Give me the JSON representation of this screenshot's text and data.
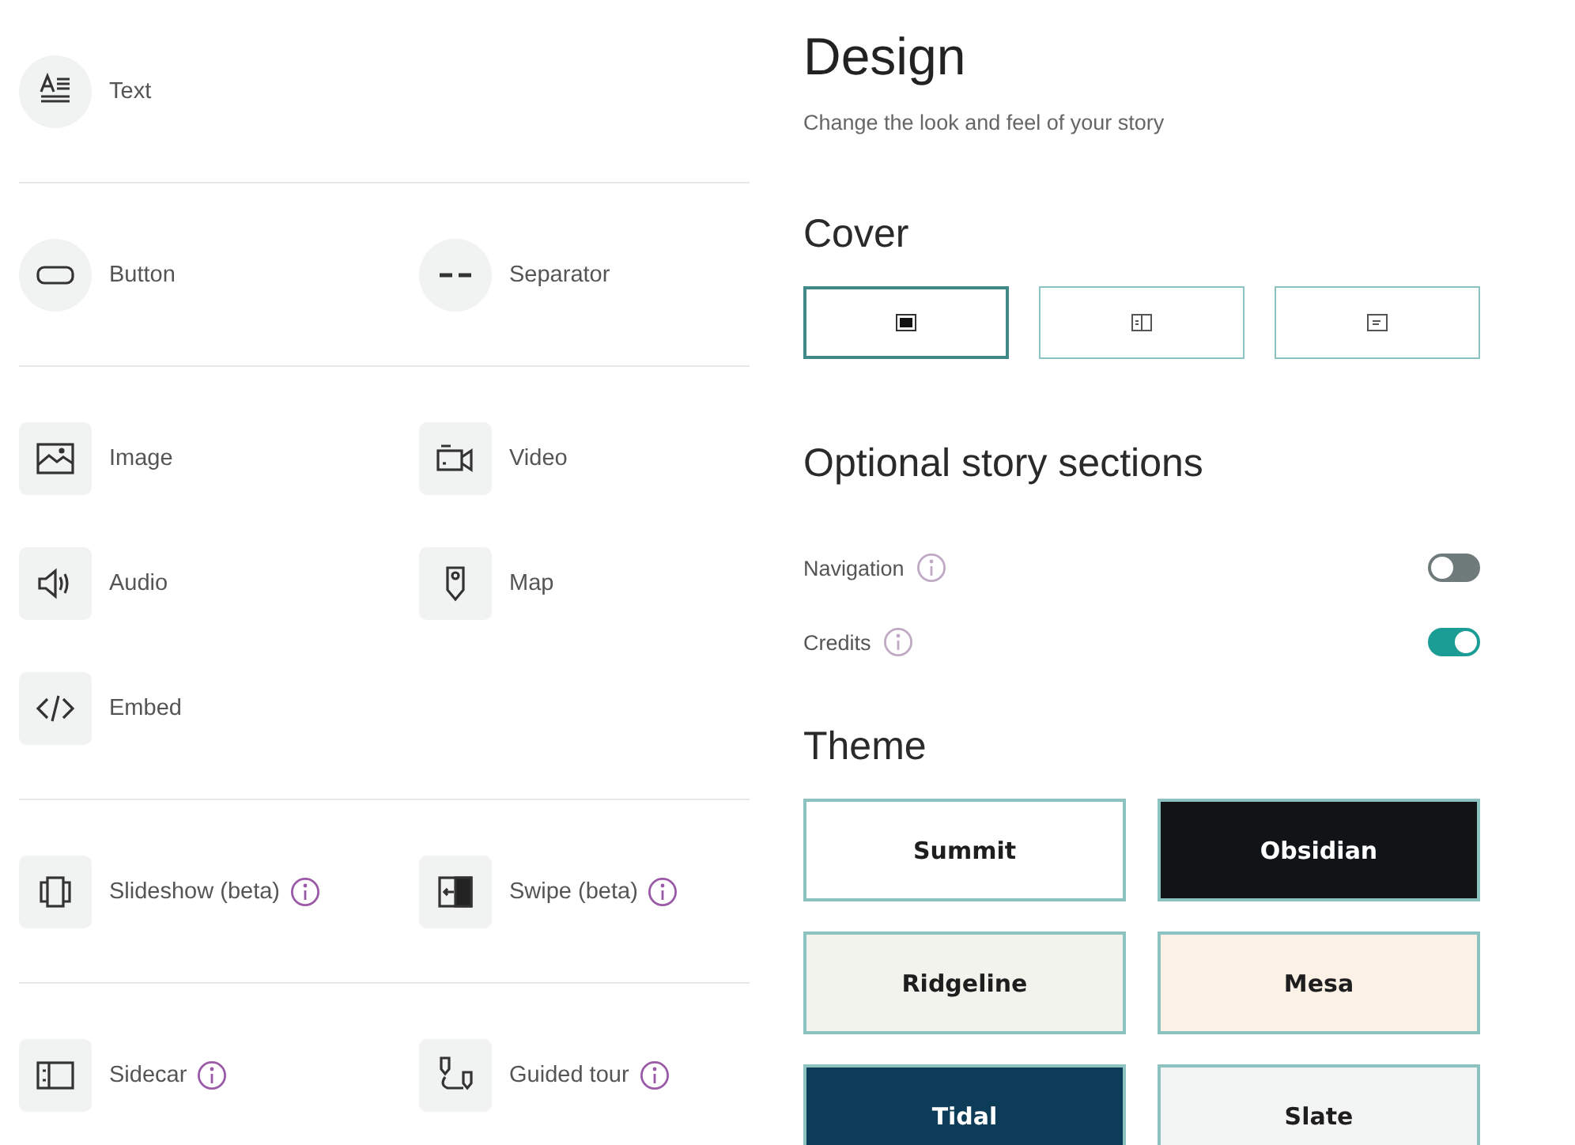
{
  "blocks": {
    "groups": [
      {
        "items": [
          {
            "kind": "text",
            "label": "Text",
            "info": false
          }
        ]
      },
      {
        "items": [
          {
            "kind": "button",
            "label": "Button",
            "info": false
          },
          {
            "kind": "separator",
            "label": "Separator",
            "info": false
          }
        ]
      },
      {
        "items": [
          {
            "kind": "image",
            "label": "Image",
            "info": false
          },
          {
            "kind": "video",
            "label": "Video",
            "info": false
          },
          {
            "kind": "audio",
            "label": "Audio",
            "info": false
          },
          {
            "kind": "map",
            "label": "Map",
            "info": false
          },
          {
            "kind": "embed",
            "label": "Embed",
            "info": false
          }
        ]
      },
      {
        "items": [
          {
            "kind": "slideshow",
            "label": "Slideshow (beta)",
            "info": true
          },
          {
            "kind": "swipe",
            "label": "Swipe (beta)",
            "info": true
          }
        ]
      },
      {
        "items": [
          {
            "kind": "sidecar",
            "label": "Sidecar",
            "info": true
          },
          {
            "kind": "tour",
            "label": "Guided tour",
            "info": true
          }
        ]
      }
    ]
  },
  "design": {
    "title": "Design",
    "subtitle": "Change the look and feel of your story",
    "cover": {
      "heading": "Cover",
      "options": [
        {
          "kind": "full",
          "selected": true
        },
        {
          "kind": "split",
          "selected": false
        },
        {
          "kind": "minimal",
          "selected": false
        }
      ]
    },
    "sections": {
      "heading": "Optional story sections",
      "toggles": [
        {
          "label": "Navigation",
          "on": false
        },
        {
          "label": "Credits",
          "on": true
        }
      ]
    },
    "theme": {
      "heading": "Theme",
      "options": [
        {
          "name": "Summit",
          "color": "#ffffff"
        },
        {
          "name": "Obsidian",
          "color": "#111417"
        },
        {
          "name": "Ridgeline",
          "color": "#f1f3ec"
        },
        {
          "name": "Mesa",
          "color": "#fbf1e6"
        },
        {
          "name": "Tidal",
          "color": "#0c3c57"
        },
        {
          "name": "Slate",
          "color": "#f3f4f4"
        }
      ]
    }
  }
}
